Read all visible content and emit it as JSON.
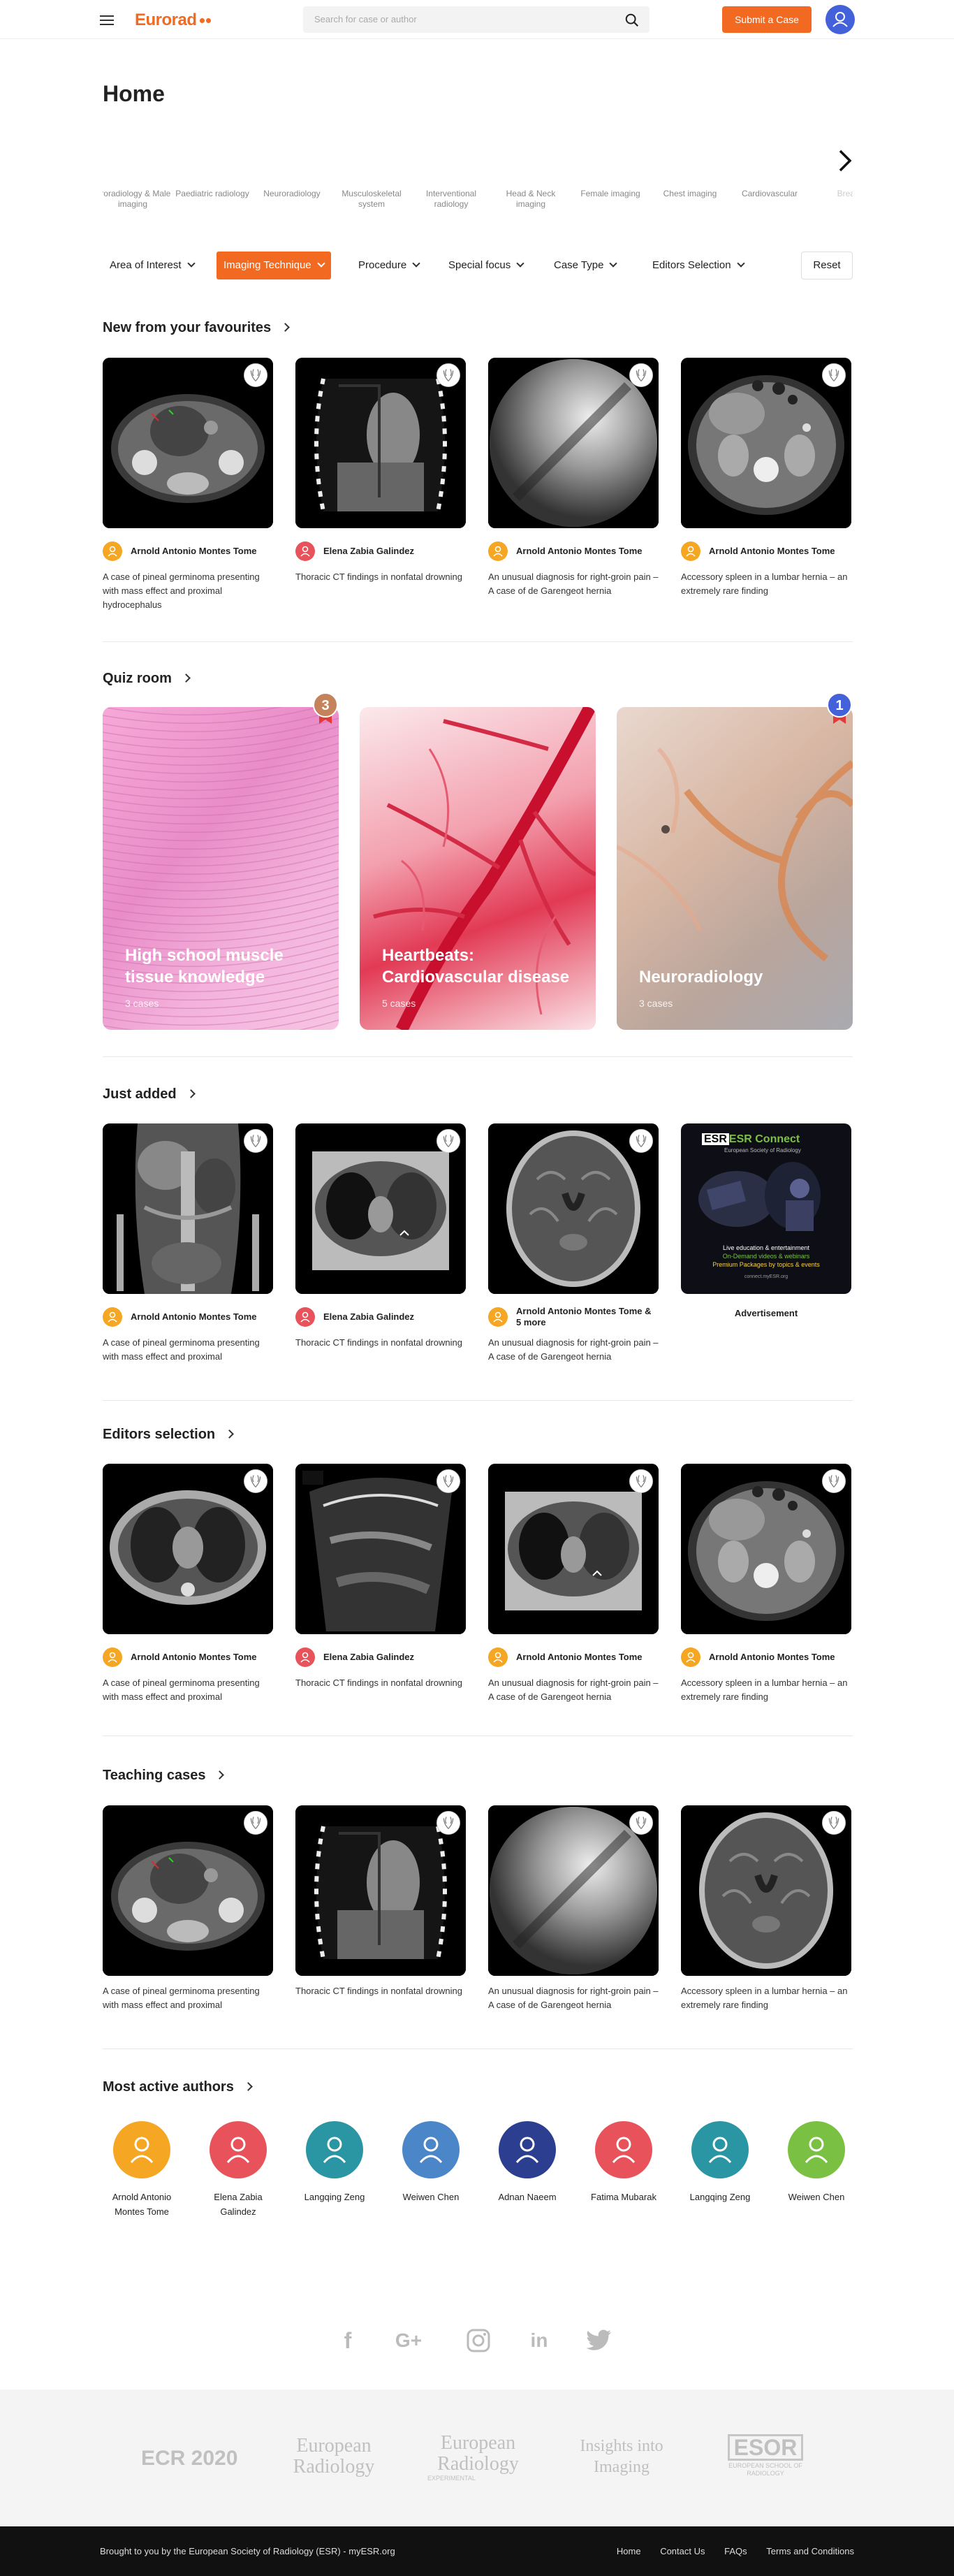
{
  "header": {
    "logo": "Eurorad",
    "search_placeholder": "Search for case or author",
    "submit_label": "Submit a Case"
  },
  "page_title": "Home",
  "categories": [
    {
      "label": "Uroradiology & Male imaging",
      "icon": "kidney-icon"
    },
    {
      "label": "Paediatric radiology",
      "icon": "child-icon"
    },
    {
      "label": "Neuroradiology",
      "icon": "head-brain-icon"
    },
    {
      "label": "Musculoskeletal system",
      "icon": "joint-icon"
    },
    {
      "label": "Interventional radiology",
      "icon": "syringe-icon"
    },
    {
      "label": "Head & Neck imaging",
      "icon": "face-icon"
    },
    {
      "label": "Female imaging",
      "icon": "uterus-icon"
    },
    {
      "label": "Chest imaging",
      "icon": "lungs-icon"
    },
    {
      "label": "Cardiovascular",
      "icon": "heart-icon"
    },
    {
      "label": "Breast",
      "icon": "breast-icon"
    }
  ],
  "filters": [
    {
      "label": "Area of Interest",
      "active": false
    },
    {
      "label": "Imaging Technique",
      "active": true
    },
    {
      "label": "Procedure",
      "active": false
    },
    {
      "label": "Special focus",
      "active": false
    },
    {
      "label": "Case Type",
      "active": false
    },
    {
      "label": "Editors Selection",
      "active": false
    }
  ],
  "reset_label": "Reset",
  "sections": {
    "favourites": {
      "title": "New from your favourites",
      "cards": [
        {
          "author": "Arnold Antonio Montes Tome",
          "desc": "A case of pineal germinoma presenting with mass effect and proximal hydrocephalus",
          "image": "ct-pelvis"
        },
        {
          "author": "Elena Zabia Galindez",
          "desc": "Thoracic CT findings in nonfatal drowning",
          "image": "ct-chest-coronal"
        },
        {
          "author": "Arnold Antonio Montes Tome",
          "desc": "An unusual diagnosis for right-groin pain – A case of de Garengeot hernia",
          "image": "fluoro"
        },
        {
          "author": "Arnold Antonio Montes Tome",
          "desc": "Accessory spleen in a lumbar hernia – an extremely rare finding",
          "image": "ct-abdomen"
        }
      ]
    },
    "quiz": {
      "title": "Quiz room",
      "cards": [
        {
          "title": "High school muscle tissue knowledge",
          "sub": "3 cases",
          "medal": "3"
        },
        {
          "title": "Heartbeats: Cardiovascular disease",
          "sub": "5 cases",
          "medal": ""
        },
        {
          "title": "Neuroradiology",
          "sub": "3 cases",
          "medal": "1"
        }
      ]
    },
    "just_added": {
      "title": "Just added",
      "cards": [
        {
          "author": "Arnold Antonio Montes Tome",
          "desc": "A case of pineal germinoma presenting with mass effect and proximal",
          "image": "ct-coronal-abdomen"
        },
        {
          "author": "Elena Zabia Galindez",
          "desc": "Thoracic CT findings in nonfatal drowning",
          "image": "ct-chest-axial"
        },
        {
          "author": "Arnold Antonio Montes Tome & 5 more",
          "desc": "An unusual diagnosis for right-groin pain – A case of de Garengeot hernia",
          "image": "mri-brain"
        }
      ],
      "ad": {
        "brand": "ESR Connect",
        "tagline": "European Society of Radiology",
        "line1": "Live education & entertainment",
        "line2": "On-Demand videos & webinars",
        "line3": "Premium Packages by topics & events",
        "url": "connect.myESR.org",
        "label": "Advertisement"
      }
    },
    "editors": {
      "title": "Editors selection",
      "cards": [
        {
          "author": "Arnold Antonio Montes Tome",
          "desc": "A case of pineal germinoma presenting with mass effect and proximal",
          "image": "ct-chest-axial2"
        },
        {
          "author": "Elena Zabia Galindez",
          "desc": "Thoracic CT findings in nonfatal drowning",
          "image": "ultrasound"
        },
        {
          "author": "Arnold Antonio Montes Tome",
          "desc": "An unusual diagnosis for right-groin pain – A case of de Garengeot hernia",
          "image": "ct-chest-axial"
        },
        {
          "author": "Arnold Antonio Montes Tome",
          "desc": "Accessory spleen in a lumbar hernia – an extremely rare finding",
          "image": "ct-abdomen"
        }
      ]
    },
    "teaching": {
      "title": "Teaching cases",
      "cards": [
        {
          "desc": "A case of pineal germinoma presenting with mass effect and proximal",
          "image": "ct-pelvis"
        },
        {
          "desc": "Thoracic CT findings in nonfatal drowning",
          "image": "ct-chest-coronal"
        },
        {
          "desc": "An unusual diagnosis for right-groin pain – A case of de Garengeot hernia",
          "image": "fluoro"
        },
        {
          "desc": "Accessory spleen in a lumbar hernia – an extremely rare finding",
          "image": "mri-brain"
        }
      ]
    },
    "authors": {
      "title": "Most active authors",
      "list": [
        {
          "name": "Arnold Antonio Montes Tome",
          "color": "#f5a623"
        },
        {
          "name": "Elena Zabia Galindez",
          "color": "#e8525a"
        },
        {
          "name": "Langqing Zeng",
          "color": "#2a96a3"
        },
        {
          "name": "Weiwen Chen",
          "color": "#4a86c8"
        },
        {
          "name": "Adnan Naeem",
          "color": "#2c3e8f"
        },
        {
          "name": "Fatima Mubarak",
          "color": "#e8525a"
        },
        {
          "name": "Langqing Zeng",
          "color": "#2a96a3"
        },
        {
          "name": "Weiwen Chen",
          "color": "#7ac143"
        }
      ]
    }
  },
  "author_colors": {
    "Arnold Antonio Montes Tome": "#f5a623",
    "Elena Zabia Galindez": "#e8525a",
    "Arnold Antonio Montes Tome & 5 more": "#f5a623"
  },
  "social": [
    "facebook-icon",
    "google-plus-icon",
    "instagram-icon",
    "linkedin-icon",
    "twitter-icon"
  ],
  "partners": [
    {
      "text": "ECR 2020"
    },
    {
      "text": "European Radiology"
    },
    {
      "text": "European Radiology",
      "sub": "EXPERIMENTAL"
    },
    {
      "text": "Insights into Imaging"
    },
    {
      "text": "ESOR",
      "sub": "EUROPEAN SCHOOL OF RADIOLOGY"
    }
  ],
  "footer": {
    "copyright": "Brought to you by the European Society of Radiology (ESR) - myESR.org",
    "links": [
      "Home",
      "Contact Us",
      "FAQs",
      "Terms and Conditions"
    ]
  },
  "colors": {
    "accent": "#f26a21",
    "brand_blue": "#4361d8"
  }
}
